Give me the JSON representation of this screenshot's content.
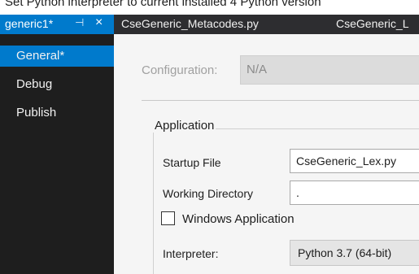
{
  "caption": "Set Python interpreter to current installed 4 Python version",
  "tabs": {
    "active": {
      "label": "generic1*",
      "pin_icon": "pin-icon",
      "close_icon": "close-icon"
    },
    "others": [
      "CseGeneric_Metacodes.py",
      "CseGeneric_L"
    ]
  },
  "sidebar": {
    "items": [
      {
        "label": "General*",
        "selected": true
      },
      {
        "label": "Debug",
        "selected": false
      },
      {
        "label": "Publish",
        "selected": false
      }
    ]
  },
  "main": {
    "configuration": {
      "label": "Configuration:",
      "value": "N/A"
    },
    "application": {
      "title": "Application",
      "startup_file": {
        "label": "Startup File",
        "value": "CseGeneric_Lex.py"
      },
      "working_directory": {
        "label": "Working Directory",
        "value": "."
      },
      "windows_application": {
        "label": "Windows Application",
        "checked": false
      },
      "interpreter": {
        "label": "Interpreter:",
        "value": "Python 3.7 (64-bit)"
      }
    }
  },
  "colors": {
    "accent": "#007acc",
    "tabbar": "#2d2d30",
    "sidebar": "#1e1e1e",
    "panel": "#f5f5f5"
  }
}
